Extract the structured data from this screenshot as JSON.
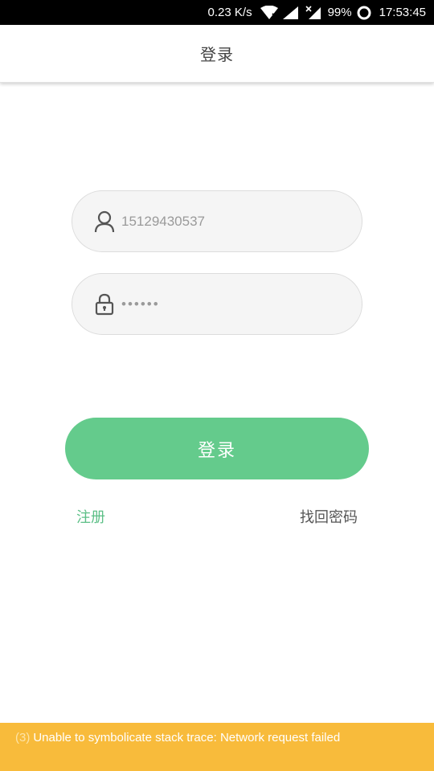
{
  "status_bar": {
    "net_speed": "0.23 K/s",
    "battery_pct": "99%",
    "time": "17:53:45"
  },
  "header": {
    "title": "登录"
  },
  "login_form": {
    "username_value": "15129430537",
    "password_value": "••••••",
    "submit_label": "登录"
  },
  "links": {
    "register": "注册",
    "forgot_password": "找回密码"
  },
  "warning": {
    "count": "(3)",
    "message": "Unable to symbolicate stack trace: Network request failed"
  },
  "colors": {
    "accent_green": "#64cb8c",
    "link_green": "#5cbf86",
    "warning_yellow": "#f8bb3b"
  },
  "icons": [
    "wifi-icon",
    "cell-signal-icon",
    "cell-signal-no-data-icon",
    "battery-ring-icon",
    "user-icon",
    "lock-icon"
  ]
}
